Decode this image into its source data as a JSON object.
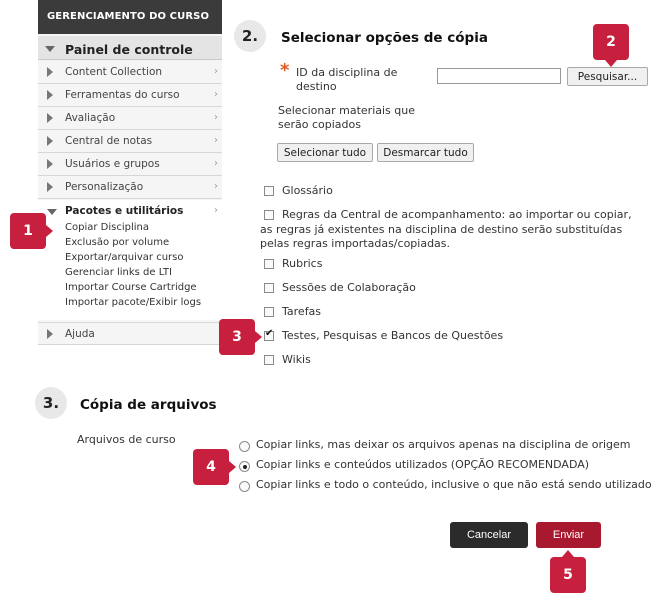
{
  "sidebar": {
    "header": "GERENCIAMENTO DO CURSO",
    "panel_heading": "Painel de controle",
    "items": [
      {
        "label": "Content Collection"
      },
      {
        "label": "Ferramentas do curso"
      },
      {
        "label": "Avaliação"
      },
      {
        "label": "Central de notas"
      },
      {
        "label": "Usuários e grupos"
      },
      {
        "label": "Personalização"
      }
    ],
    "tools_heading": "Pacotes e utilitários",
    "tools_links": [
      "Copiar Disciplina",
      "Exclusão por volume",
      "Exportar/arquivar curso",
      "Gerenciar links de LTI",
      "Importar Course Cartridge",
      "Importar pacote/Exibir logs"
    ],
    "help": "Ajuda",
    "chevron": "›"
  },
  "section2": {
    "number": "2.",
    "title": "Selecionar opções de cópia",
    "required_mark": "*",
    "dest_label": "ID da disciplina de destino",
    "dest_value": "",
    "search_button": "Pesquisar...",
    "materials_label": "Selecionar materiais que serão copiados",
    "select_all": "Selecionar tudo",
    "deselect_all": "Desmarcar tudo",
    "options": [
      {
        "label": "Glossário",
        "checked": false
      },
      {
        "label": "Regras da Central de acompanhamento: ao importar ou copiar,",
        "continuation": "as regras já existentes na disciplina de destino serão substituídas pelas regras importadas/copiadas.",
        "checked": false
      },
      {
        "label": "Rubrics",
        "checked": false
      },
      {
        "label": "Sessões de Colaboração",
        "checked": false
      },
      {
        "label": "Tarefas",
        "checked": false
      },
      {
        "label": "Testes, Pesquisas e Bancos de Questões",
        "checked": true
      },
      {
        "label": "Wikis",
        "checked": false
      }
    ]
  },
  "section3": {
    "number": "3.",
    "title": "Cópia de arquivos",
    "files_label": "Arquivos de curso",
    "radios": [
      {
        "label": "Copiar links, mas deixar os arquivos apenas na disciplina de origem",
        "checked": false
      },
      {
        "label": "Copiar links e conteúdos utilizados (OPÇÃO RECOMENDADA)",
        "checked": true
      },
      {
        "label": "Copiar links e todo o conteúdo, inclusive o que não está sendo utilizado",
        "checked": false
      }
    ]
  },
  "actions": {
    "cancel": "Cancelar",
    "submit": "Enviar"
  },
  "callouts": [
    "1",
    "2",
    "3",
    "4",
    "5"
  ],
  "colors": {
    "callout": "#c6203e",
    "submit": "#a8192f",
    "cancel": "#2b2b2b",
    "sidebar_header": "#3b3b3b",
    "required": "#e05a1f"
  }
}
